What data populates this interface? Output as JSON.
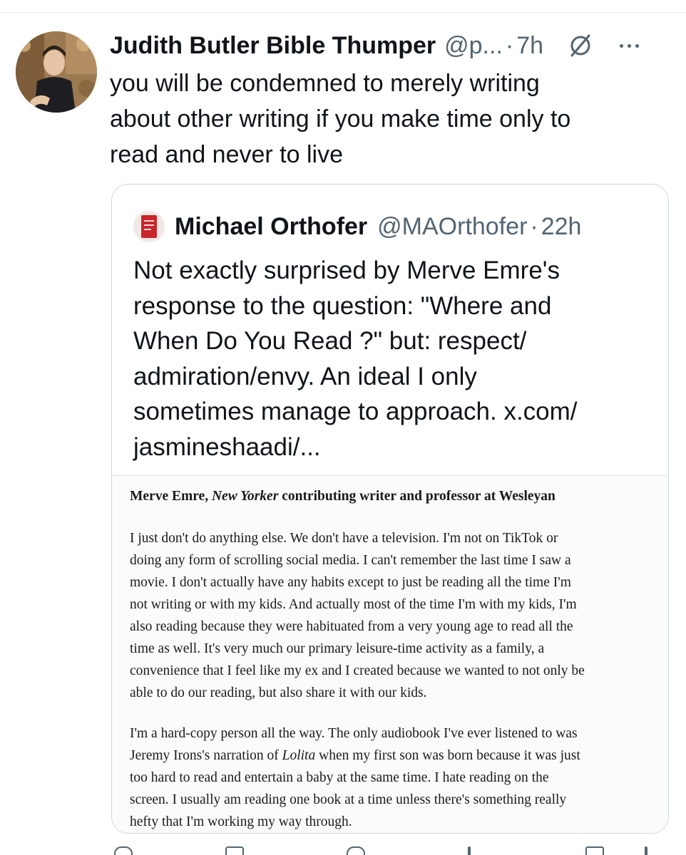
{
  "tweet": {
    "display_name": "Judith Butler Bible Thumper",
    "handle": "@p...",
    "separator": "·",
    "time": "7h",
    "text": "you will be condemned to merely writing\nabout other writing if you make time only to\nread and never to live",
    "icons": {
      "grok": "slashed-circle-icon",
      "more": "more-options-icon"
    }
  },
  "quoted_tweet": {
    "display_name": "Michael Orthofer",
    "handle": "@MAOrthofer",
    "separator": "·",
    "time": "22h",
    "text": "Not exactly surprised by Merve Emre's\nresponse to the question: \"Where and\nWhen Do You Read ?\" but: respect/\nadmiration/envy. An ideal I only\nsometimes manage to approach. x.com/\njasmineshaadi/...",
    "image": {
      "heading_name": "Merve Emre, ",
      "heading_publication": "New Yorker",
      "heading_rest": " contributing writer and professor at Wesleyan",
      "paragraph1": "I just don't do anything else. We don't have a television. I'm not on TikTok or\ndoing any form of scrolling social media. I can't remember the last time I saw a\nmovie. I don't actually have any habits except to just be reading all the time I'm\nnot writing or with my kids. And actually most of the time I'm with my kids, I'm\nalso reading because they were habituated from a very young age to read all the\ntime as well. It's very much our primary leisure-time activity as a family, a\nconvenience that I feel like my ex and I created because we wanted to not only be\nable to do our reading, but also share it with our kids.",
      "paragraph2_a": "I'm a hard-copy person all the way. The only audiobook I've ever listened to was\nJeremy Irons's narration of ",
      "paragraph2_title": "Lolita",
      "paragraph2_b": " when my first son was born because it was just\ntoo hard to read and entertain a baby at the same time. I hate reading on the\nscreen. I usually am reading one book at a time unless there's something really\nhefty that I'm working my way through."
    }
  },
  "actions": {
    "icons": [
      "reply-icon",
      "retweet-icon",
      "like-icon",
      "views-icon",
      "bookmark-icon",
      "share-icon"
    ]
  },
  "colors": {
    "text_primary": "#0f1419",
    "text_secondary": "#536471",
    "border": "#cfd9de"
  }
}
